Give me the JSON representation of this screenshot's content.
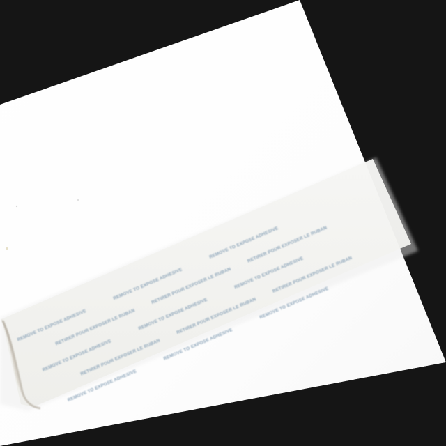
{
  "photo": {
    "subject": "",
    "background_color": "#151515",
    "paper_color": "#ffffff",
    "strip_text_color": "#8aa3b8"
  },
  "strip": {
    "rows": [
      [
        "REMOVE TO EXPOSE ADHESIVE",
        "REMOVE TO EXPOSE ADHESIVE",
        "REMOVE TO EXPOSE ADHESIVE"
      ],
      [
        "RETIRER POUR EXPOSER LE RUBAN",
        "RETIRER POUR EXPOSER LE RUBAN",
        "RETIRER POUR EXPOSER LE RUBAN"
      ],
      [
        "REMOVE TO EXPOSE ADHESIVE",
        "REMOVE TO EXPOSE ADHESIVE",
        "REMOVE TO EXPOSE ADHESIVE"
      ],
      [
        "RETIRER POUR EXPOSER LE RUBAN",
        "RETIRER POUR EXPOSER LE RUBAN",
        "RETIRER POUR EXPOSER LE RUBAN"
      ],
      [
        "REMOVE TO EXPOSE ADHESIVE",
        "REMOVE TO EXPOSE ADHESIVE",
        "REMOVE TO EXPOSE ADHESIVE"
      ]
    ]
  }
}
